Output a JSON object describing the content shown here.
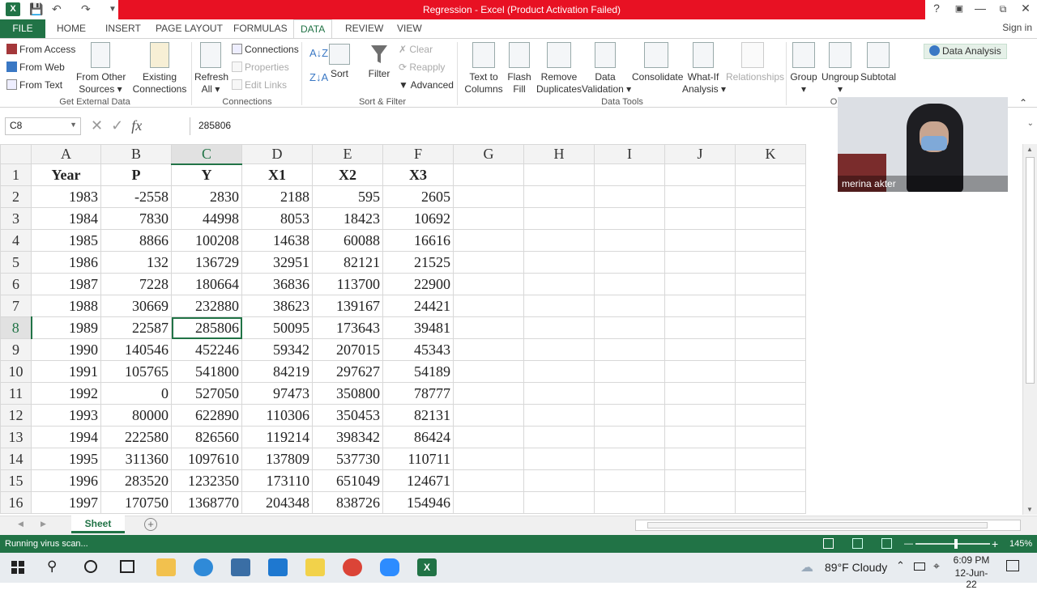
{
  "window": {
    "title": "Regression - Excel (Product Activation Failed)",
    "help": "?",
    "signin": "Sign in"
  },
  "tabs": [
    "FILE",
    "HOME",
    "INSERT",
    "PAGE LAYOUT",
    "FORMULAS",
    "DATA",
    "REVIEW",
    "VIEW"
  ],
  "ribbon": {
    "get_external": {
      "from_access": "From Access",
      "from_web": "From Web",
      "from_text": "From Text",
      "from_other": "From Other",
      "sources": "Sources",
      "existing": "Existing",
      "connections_lbl": "Connections",
      "group": "Get External Data"
    },
    "connections": {
      "refresh": "Refresh",
      "all": "All",
      "connections": "Connections",
      "properties": "Properties",
      "edit_links": "Edit Links",
      "group": "Connections"
    },
    "sort_filter": {
      "sort": "Sort",
      "filter": "Filter",
      "clear": "Clear",
      "reapply": "Reapply",
      "advanced": "Advanced",
      "group": "Sort & Filter"
    },
    "data_tools": {
      "text_to": "Text to",
      "columns": "Columns",
      "flash": "Flash",
      "fill": "Fill",
      "remove": "Remove",
      "duplicates": "Duplicates",
      "data": "Data",
      "validation": "Validation",
      "consolidate": "Consolidate",
      "whatif": "What-If",
      "analysis": "Analysis",
      "relationships": "Relationships",
      "group": "Data Tools"
    },
    "outline": {
      "group_btn": "Group",
      "ungroup": "Ungroup",
      "subtotal": "Subtotal",
      "group": "O"
    },
    "analysis": {
      "data_analysis": "Data Analysis"
    }
  },
  "formula_bar": {
    "name_box": "C8",
    "fx": "fx",
    "value": "285806"
  },
  "columns": [
    "A",
    "B",
    "C",
    "D",
    "E",
    "F",
    "G",
    "H",
    "I",
    "J",
    "K"
  ],
  "header_row": [
    "Year",
    "P",
    "Y",
    "X1",
    "X2",
    "X3"
  ],
  "rows": [
    [
      "1983",
      "-2558",
      "2830",
      "2188",
      "595",
      "2605"
    ],
    [
      "1984",
      "7830",
      "44998",
      "8053",
      "18423",
      "10692"
    ],
    [
      "1985",
      "8866",
      "100208",
      "14638",
      "60088",
      "16616"
    ],
    [
      "1986",
      "132",
      "136729",
      "32951",
      "82121",
      "21525"
    ],
    [
      "1987",
      "7228",
      "180664",
      "36836",
      "113700",
      "22900"
    ],
    [
      "1988",
      "30669",
      "232880",
      "38623",
      "139167",
      "24421"
    ],
    [
      "1989",
      "22587",
      "285806",
      "50095",
      "173643",
      "39481"
    ],
    [
      "1990",
      "140546",
      "452246",
      "59342",
      "207015",
      "45343"
    ],
    [
      "1991",
      "105765",
      "541800",
      "84219",
      "297627",
      "54189"
    ],
    [
      "1992",
      "0",
      "527050",
      "97473",
      "350800",
      "78777"
    ],
    [
      "1993",
      "80000",
      "622890",
      "110306",
      "350453",
      "82131"
    ],
    [
      "1994",
      "222580",
      "826560",
      "119214",
      "398342",
      "86424"
    ],
    [
      "1995",
      "311360",
      "1097610",
      "137809",
      "537730",
      "110711"
    ],
    [
      "1996",
      "283520",
      "1232350",
      "173110",
      "651049",
      "124671"
    ],
    [
      "1997",
      "170750",
      "1368770",
      "204348",
      "838726",
      "154946"
    ]
  ],
  "sheet_tab": "Sheet",
  "status": {
    "text": "Running virus scan...",
    "zoom": "145%"
  },
  "webcam": {
    "name": "merina akter"
  },
  "taskbar": {
    "weather": "89°F  Cloudy",
    "time": "6:09 PM",
    "date": "12-Jun-22"
  }
}
